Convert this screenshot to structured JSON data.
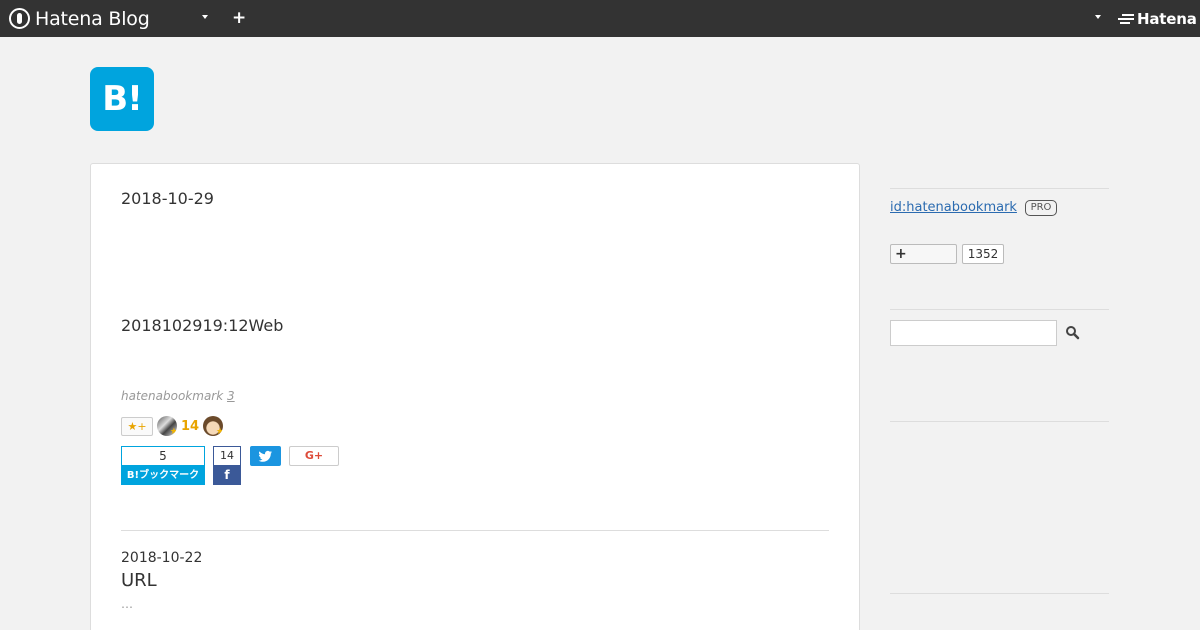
{
  "topbar": {
    "brand": "Hatena Blog",
    "plus_symbol": "+",
    "hatena": "Hatena"
  },
  "blog_icon_text": "B!",
  "entry": {
    "date": "2018-10-29",
    "body": "2018102919:12Web",
    "author": "hatenabookmark",
    "author_count": "3",
    "star_add_label": "★+",
    "star_count": "14",
    "hatena_bookmark_count": "5",
    "hatena_bookmark_label": "B!ブックマーク",
    "facebook_count": "14",
    "facebook_label": "f",
    "googleplus_label": "G+"
  },
  "entry2": {
    "date": "2018-10-22",
    "title": "URL",
    "more": "…"
  },
  "sidebar": {
    "user_id": "id:hatenabookmark",
    "pro_badge": "PRO",
    "follow_label": "+",
    "follow_count": "1352",
    "search_placeholder": ""
  },
  "colors": {
    "topbar": "#333333",
    "hatena_blue": "#00a4de",
    "facebook": "#3b5998",
    "twitter": "#1b95e0",
    "star": "#e8a400",
    "link": "#2b6bb0"
  },
  "icons": [
    "hatena-blog-logo-icon",
    "chevron-down-icon",
    "plus-icon",
    "hatena-logo-icon",
    "twitter-icon",
    "facebook-icon",
    "search-icon"
  ]
}
